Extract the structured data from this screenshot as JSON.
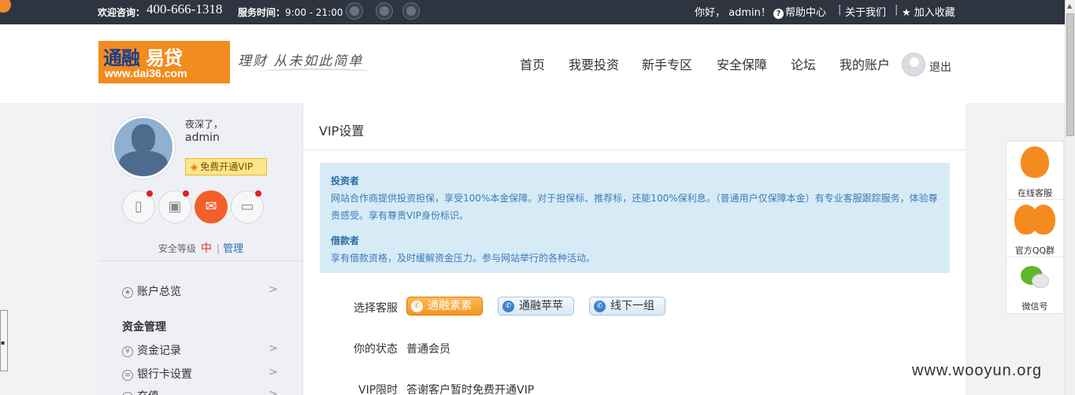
{
  "topbar": {
    "welcome": "欢迎咨询：",
    "phone": "400-666-1318",
    "service_label": "服务时间：",
    "service_hours": "9:00 - 21:00",
    "social_icons": [
      "wechat-icon",
      "weibo-icon",
      "qq-icon"
    ],
    "hello": "你好， admin！",
    "help_center": "帮助中心",
    "about_us": "关于我们",
    "bookmark": "加入收藏",
    "separator": "|"
  },
  "header": {
    "logo_cn_part1": "通融",
    "logo_cn_part2": "易贷",
    "logo_url": "www.dai36.com",
    "slogan": "理财 从未如此简单",
    "nav": [
      "首页",
      "我要投资",
      "新手专区",
      "安全保障",
      "论坛",
      "我的账户"
    ],
    "logout": "退出"
  },
  "sidebar": {
    "greeting": "夜深了，",
    "username": "admin",
    "vip_button": "免费开通VIP",
    "security_label": "安全等级",
    "security_level": "中",
    "manage": "管理",
    "items": [
      {
        "label": "账户总览",
        "icon": "star-icon"
      },
      {
        "label": "资金记录",
        "icon": "yen-icon"
      },
      {
        "label": "银行卡设置",
        "icon": "card-icon"
      },
      {
        "label": "充值",
        "icon": "plus-icon"
      }
    ],
    "section_heading": "资金管理"
  },
  "content": {
    "title": "VIP设置",
    "info": {
      "investor_heading": "投资者",
      "investor_text": "网站合作商提供投资担保，享受100%本金保障。对于担保标、推荐标，还能100%保利息。（普通用户仅保障本金）有专业客服跟踪服务，体验尊贵感受。享有尊贵VIP身份标识。",
      "borrower_heading": "借款者",
      "borrower_text": "享有借款资格，及时缓解资金压力。参与网站举行的各种活动。"
    },
    "service_label": "选择客服",
    "service_options": [
      "通融素素",
      "通融苹苹",
      "线下一组"
    ],
    "status_label": "你的状态",
    "status_value": "普通会员",
    "vip_limit_label": "VIP限时",
    "vip_limit_value": "答谢客户暂时免费开通VIP"
  },
  "floatbar": {
    "online_service": "在线客服",
    "qq_group": "官方QQ群",
    "wechat": "微信号"
  },
  "watermark": "www.wooyun.org",
  "colors": {
    "topbar": "#2e3440",
    "accent_orange": "#f28c1e",
    "info_bg": "#d7ebf6",
    "link_blue": "#2b6cb0"
  }
}
